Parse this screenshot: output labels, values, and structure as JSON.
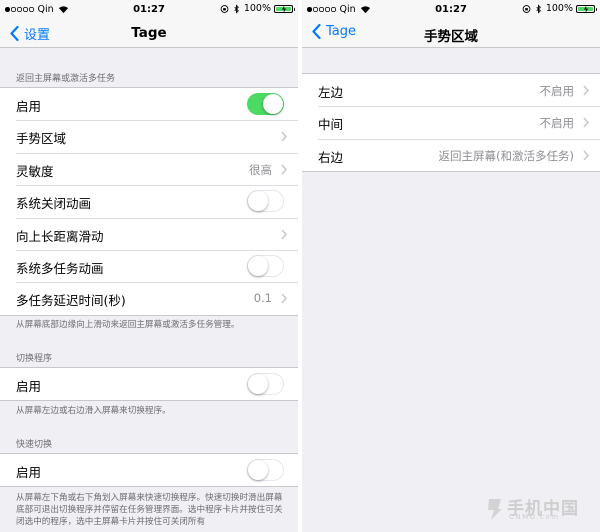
{
  "left": {
    "status": {
      "carrier": "Qin",
      "time": "01:27",
      "battery": "100%"
    },
    "nav": {
      "back": "设置",
      "title": "Tage"
    },
    "sections": {
      "s1_header": "返回主屏幕或激活多任务",
      "s1_rows": {
        "enable": "启用",
        "gesture_area": "手势区域",
        "sensitivity": "灵敏度",
        "sensitivity_value": "很高",
        "close_anim": "系统关闭动画",
        "long_swipe": "向上长距离滑动",
        "multitask_anim": "系统多任务动画",
        "delay": "多任务延迟时间(秒)",
        "delay_value": "0.1"
      },
      "s1_footer": "从屏幕底部边缘向上滑动来返回主屏幕或激活多任务管理。",
      "s2_header": "切换程序",
      "s2_enable": "启用",
      "s2_footer": "从屏幕左边或右边滑入屏幕来切换程序。",
      "s3_header": "快速切换",
      "s3_enable": "启用",
      "s3_footer": "从屏幕左下角或右下角划入屏幕来快速切换程序。快速切换时滑出屏幕底部可退出切换程序并停留在任务管理界面。选中程序卡片并按住可关闭选中的程序，选中主屏幕卡片并按住可关闭所有"
    },
    "toggles": {
      "enable": true,
      "close_anim": false,
      "multitask_anim": false,
      "s2_enable": false,
      "s3_enable": false
    }
  },
  "right": {
    "status": {
      "carrier": "Qin",
      "time": "01:27",
      "battery": "100%"
    },
    "nav": {
      "back": "Tage",
      "title": "手势区域"
    },
    "rows": [
      {
        "label": "左边",
        "value": "不启用"
      },
      {
        "label": "中间",
        "value": "不启用"
      },
      {
        "label": "右边",
        "value": "返回主屏幕(和激活多任务)"
      }
    ]
  },
  "watermark": {
    "text": "手机中国",
    "sub": "CNMO.com"
  },
  "colors": {
    "accent": "#007aff",
    "toggle_on": "#4cd964",
    "background": "#efeff4"
  }
}
